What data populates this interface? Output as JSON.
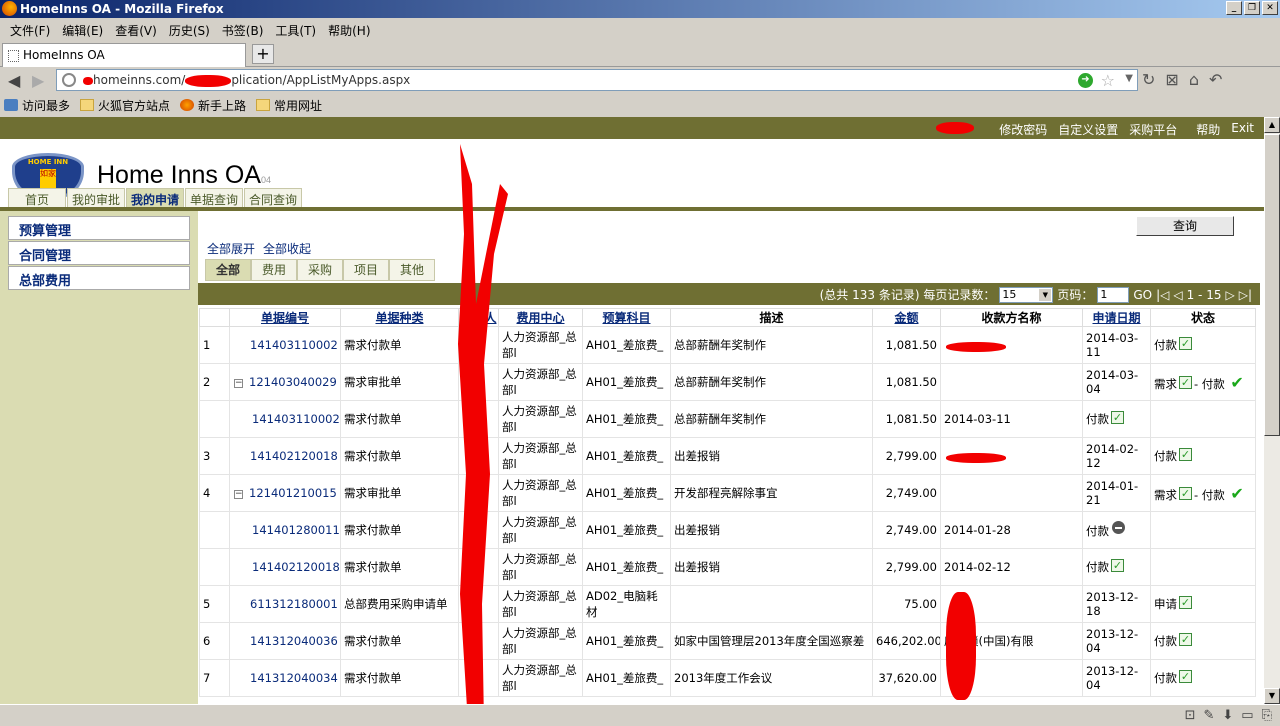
{
  "window": {
    "title": "HomeInns OA - Mozilla Firefox"
  },
  "menu": [
    "文件(F)",
    "编辑(E)",
    "查看(V)",
    "历史(S)",
    "书签(B)",
    "工具(T)",
    "帮助(H)"
  ],
  "browser_tab": {
    "title": "HomeInns OA",
    "new_tab": "+"
  },
  "address_bar": {
    "url_visible_prefix": "homeinns.com/",
    "url_visible_suffix": "plication/AppListMyApps.aspx"
  },
  "bookmarks": [
    {
      "label": "访问最多",
      "icon": "most-visited-icon"
    },
    {
      "label": "火狐官方站点",
      "icon": "folder-icon"
    },
    {
      "label": "新手上路",
      "icon": "firefox-icon"
    },
    {
      "label": "常用网址",
      "icon": "folder-icon"
    }
  ],
  "top_links": [
    "修改密码",
    "自定义设置",
    "采购平台",
    "帮助",
    "Exit"
  ],
  "brand": {
    "name": "Home Inns OA",
    "version": "04",
    "logo_top": "HOME INN",
    "logo_badge": "如家"
  },
  "nav_tabs": [
    {
      "label": "首页",
      "active": false
    },
    {
      "label": "我的审批",
      "active": false
    },
    {
      "label": "我的申请",
      "active": true
    },
    {
      "label": "单据查询",
      "active": false
    },
    {
      "label": "合同查询",
      "active": false
    }
  ],
  "sidebar": [
    "预算管理",
    "合同管理",
    "总部费用"
  ],
  "query_button": "查询",
  "expand": {
    "expand_all": "全部展开",
    "collapse_all": "全部收起"
  },
  "sub_tabs": [
    {
      "label": "全部",
      "active": true
    },
    {
      "label": "费用",
      "active": false
    },
    {
      "label": "采购",
      "active": false
    },
    {
      "label": "项目",
      "active": false
    },
    {
      "label": "其他",
      "active": false
    }
  ],
  "pager": {
    "total_text": "(总共 133 条记录) 每页记录数：",
    "page_size": "15",
    "page_label": "页码：",
    "page_value": "1",
    "go": "GO",
    "range": "1 - 15"
  },
  "table": {
    "headers": [
      "",
      "单据编号",
      "单据种类",
      "申请人",
      "费用中心",
      "预算科目",
      "描述",
      "金额",
      "收款方名称",
      "申请日期",
      "状态"
    ],
    "rows": [
      {
        "idx": "1",
        "id": "141403110002",
        "type": "需求付款单",
        "center": "人力资源部_总部l",
        "subject": "AH01_差旅费_",
        "desc": "总部薪酬年奖制作",
        "amount": "1,081.50",
        "payee": "",
        "date": "2014-03-11",
        "status": "付款",
        "sub": false,
        "minus": false,
        "status2": ""
      },
      {
        "idx": "2",
        "id": "121403040029",
        "type": "需求审批单",
        "center": "人力资源部_总部l",
        "subject": "AH01_差旅费_",
        "desc": "总部薪酬年奖制作",
        "amount": "1,081.50",
        "payee": "",
        "date": "2014-03-04",
        "status": "需求",
        "sub": false,
        "minus": true,
        "status2": "- 付款"
      },
      {
        "idx": "",
        "id": "141403110002",
        "type": "需求付款单",
        "center": "人力资源部_总部l",
        "subject": "AH01_差旅费_",
        "desc": "总部薪酬年奖制作",
        "amount": "1,081.50",
        "payee": "2014-03-11",
        "date": "付款",
        "status": "",
        "sub": true,
        "minus": false,
        "status2": ""
      },
      {
        "idx": "3",
        "id": "141402120018",
        "type": "需求付款单",
        "center": "人力资源部_总部l",
        "subject": "AH01_差旅费_",
        "desc": "出差报销",
        "amount": "2,799.00",
        "payee": "",
        "date": "2014-02-12",
        "status": "付款",
        "sub": false,
        "minus": false,
        "status2": ""
      },
      {
        "idx": "4",
        "id": "121401210015",
        "type": "需求审批单",
        "center": "人力资源部_总部l",
        "subject": "AH01_差旅费_",
        "desc": "开发部程亮解除事宜",
        "amount": "2,749.00",
        "payee": "",
        "date": "2014-01-21",
        "status": "需求",
        "sub": false,
        "minus": true,
        "status2": "- 付款"
      },
      {
        "idx": "",
        "id": "141401280011",
        "type": "需求付款单",
        "center": "人力资源部_总部l",
        "subject": "AH01_差旅费_",
        "desc": "出差报销",
        "amount": "2,749.00",
        "payee": "2014-01-28",
        "date": "付款",
        "status": "",
        "sub": true,
        "minus": false,
        "status2": "",
        "stop": true
      },
      {
        "idx": "",
        "id": "141402120018",
        "type": "需求付款单",
        "center": "人力资源部_总部l",
        "subject": "AH01_差旅费_",
        "desc": "出差报销",
        "amount": "2,799.00",
        "payee": "2014-02-12",
        "date": "付款",
        "status": "",
        "sub": true,
        "minus": false,
        "status2": ""
      },
      {
        "idx": "5",
        "id": "611312180001",
        "type": "总部费用采购申请单",
        "center": "人力资源部_总部l",
        "subject": "AD02_电脑耗材",
        "desc": "",
        "amount": "75.00",
        "payee": "",
        "date": "2013-12-18",
        "status": "申请",
        "sub": false,
        "minus": false,
        "status2": ""
      },
      {
        "idx": "6",
        "id": "141312040036",
        "type": "需求付款单",
        "center": "人力资源部_总部l",
        "subject": "AH01_差旅费_",
        "desc": "如家中国管理层2013年度全国巡察差",
        "amount": "646,202.00",
        "payee": "店连锁(中国)有限",
        "date": "2013-12-04",
        "status": "付款",
        "sub": false,
        "minus": false,
        "status2": ""
      },
      {
        "idx": "7",
        "id": "141312040034",
        "type": "需求付款单",
        "center": "人力资源部_总部l",
        "subject": "AH01_差旅费_",
        "desc": "2013年度工作会议",
        "amount": "37,620.00",
        "payee": "",
        "date": "2013-12-04",
        "status": "付款",
        "sub": false,
        "minus": false,
        "status2": ""
      }
    ]
  },
  "colors": {
    "olive": "#6f6f33",
    "sidebar_bg": "#dadcb2",
    "link": "#0a2b7a",
    "redaction": "#f20000"
  }
}
